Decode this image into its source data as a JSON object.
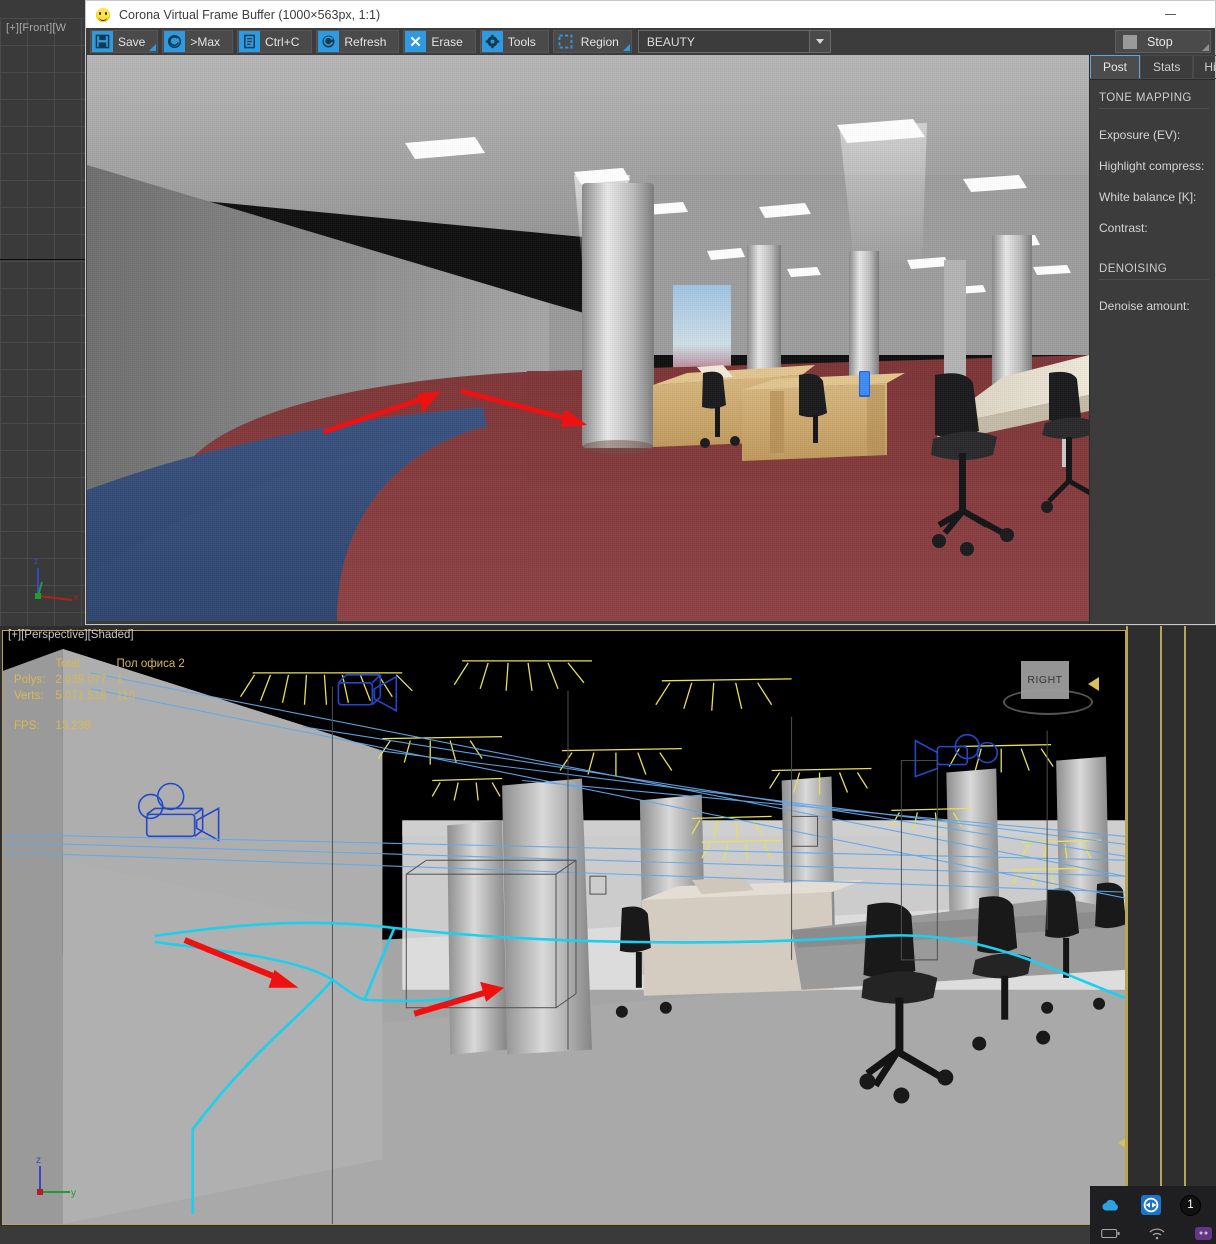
{
  "app": {
    "window_title": "Corona Virtual Frame Buffer (1000×563px, 1:1)",
    "icon": "corona-smiley-icon",
    "minimize_label": "—"
  },
  "toolbar": {
    "buttons": [
      {
        "name": "save-button",
        "label": "Save",
        "icon": "floppy-disk-icon",
        "dropdown": true
      },
      {
        "name": "to-max-button",
        "label": ">Max",
        "icon": "corona-swirl-icon",
        "dropdown": false
      },
      {
        "name": "copy-button",
        "label": "Ctrl+C",
        "icon": "clipboard-icon",
        "dropdown": false
      },
      {
        "name": "refresh-button",
        "label": "Refresh",
        "icon": "refresh-circle-icon",
        "dropdown": false
      },
      {
        "name": "erase-button",
        "label": "Erase",
        "icon": "x-cross-icon",
        "dropdown": false
      },
      {
        "name": "tools-button",
        "label": "Tools",
        "icon": "gear-icon",
        "dropdown": false
      },
      {
        "name": "region-button",
        "label": "Region",
        "icon": "dashed-square-icon",
        "dropdown": true
      }
    ],
    "pass_select": {
      "value": "BEAUTY",
      "name": "render-pass-select"
    },
    "stop_button": {
      "label": "Stop",
      "icon": "stop-square-icon"
    }
  },
  "right_panel": {
    "tabs": [
      {
        "label": "Post",
        "active": true
      },
      {
        "label": "Stats",
        "active": false
      },
      {
        "label": "Hist",
        "active": false
      }
    ],
    "sections": [
      {
        "heading": "TONE MAPPING",
        "rows": [
          {
            "label": "Exposure (EV):"
          },
          {
            "label": "Highlight compress:"
          },
          {
            "label": "White balance [K]:"
          },
          {
            "label": "Contrast:"
          }
        ]
      },
      {
        "heading": "DENOISING",
        "rows": [
          {
            "label": "Denoise amount:"
          }
        ]
      }
    ]
  },
  "max_background": {
    "front_viewport_label": "[+][Front][W"
  },
  "viewport": {
    "label": "[+][Perspective][Shaded]",
    "stats": {
      "col_headers": [
        "",
        "Total",
        "Пол офиса 2"
      ],
      "rows": [
        {
          "label": "Polys:",
          "total": "2 639 077",
          "selected": "1"
        },
        {
          "label": "Verts:",
          "total": "5 071 518",
          "selected": "110"
        }
      ],
      "fps_label": "FPS:",
      "fps_value": "13,239"
    },
    "viewcube": {
      "face_label": "RIGHT"
    },
    "axis_gizmo": {
      "x": "x",
      "y": "y",
      "z": "z"
    }
  },
  "taskbar": {
    "tray_icons": [
      {
        "name": "onedrive-cloud-icon"
      },
      {
        "name": "teamviewer-icon"
      },
      {
        "name": "notification-count-badge",
        "label": "1"
      }
    ],
    "status_icons": [
      {
        "name": "battery-icon"
      },
      {
        "name": "wifi-icon"
      },
      {
        "name": "purple-app-icon"
      }
    ]
  },
  "colors": {
    "accent_blue": "#2f9ae0",
    "toolbar_bg": "#3c3c3c",
    "annotation_red": "#ee1111",
    "gold_border": "#b9a55a",
    "stats_yellow": "#d8b950",
    "carpet_red": "#8c3d3f",
    "carpet_blue": "#3c5480",
    "selection_cyan": "#19d0f0",
    "light_gizmo_yellow": "#e8e05a",
    "camera_gizmo_blue": "#2448cc"
  }
}
